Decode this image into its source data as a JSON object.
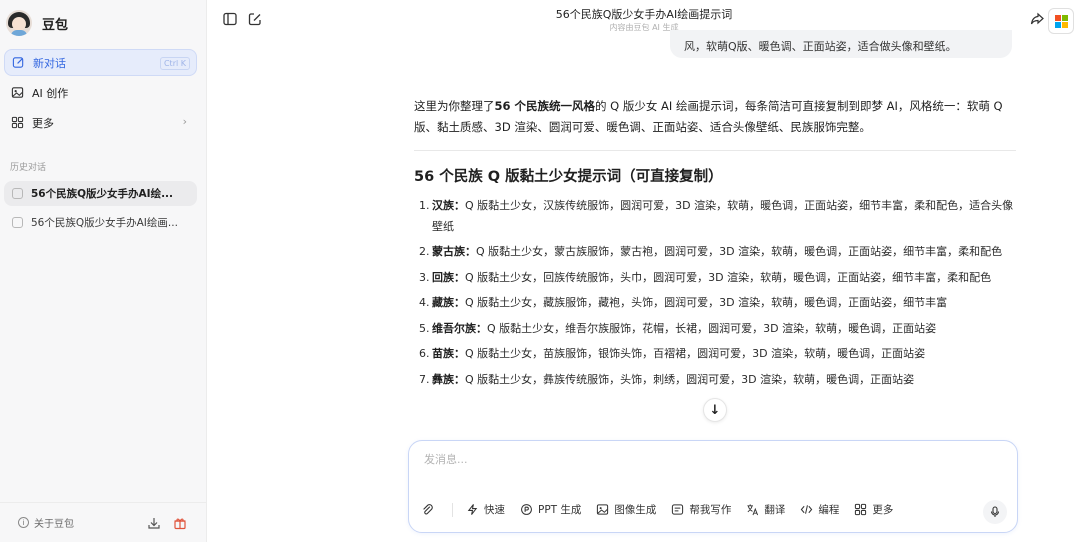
{
  "sidebar": {
    "brand_name": "豆包",
    "nav": [
      {
        "label": "新对话",
        "shortcut": "Ctrl K",
        "icon": "edit-icon",
        "active": true
      },
      {
        "label": "AI 创作",
        "icon": "image-icon"
      },
      {
        "label": "更多",
        "icon": "grid-icon"
      }
    ],
    "history_label": "历史对话",
    "history": [
      {
        "title": "56个民族Q版少女手办AI绘..."
      },
      {
        "title": "56个民族Q版少女手办AI绘画..."
      }
    ],
    "footer_label": "关于豆包"
  },
  "header": {
    "title": "56个民族Q版少女手办AI绘画提示词",
    "subtitle": "内容由豆包 AI 生成"
  },
  "chat": {
    "user_message_tail": "风，软萌Q版、暖色调、正面站姿，适合做头像和壁纸。",
    "intro_prefix": "这里为你整理了",
    "intro_bold": "56 个民族统一风格",
    "intro_mid": "的 Q 版少女 AI 绘画提示词，每条简洁可直接复制到即梦 AI，风格统一：软萌 Q 版、黏土质感、3D 渲染、圆润可爱、暖色调、正面站姿、适合头像壁纸、民族服饰完整。",
    "section_title": "56 个民族 Q 版黏土少女提示词（可直接复制）",
    "prompts": [
      {
        "num": "1.",
        "ethnic": "汉族：",
        "text": "Q 版黏土少女，汉族传统服饰，圆润可爱，3D 渲染，软萌，暖色调，正面站姿，细节丰富，柔和配色，适合头像壁纸"
      },
      {
        "num": "2.",
        "ethnic": "蒙古族：",
        "text": "Q 版黏土少女，蒙古族服饰，蒙古袍，圆润可爱，3D 渲染，软萌，暖色调，正面站姿，细节丰富，柔和配色"
      },
      {
        "num": "3.",
        "ethnic": "回族：",
        "text": "Q 版黏土少女，回族传统服饰，头巾，圆润可爱，3D 渲染，软萌，暖色调，正面站姿，细节丰富，柔和配色"
      },
      {
        "num": "4.",
        "ethnic": "藏族：",
        "text": "Q 版黏土少女，藏族服饰，藏袍，头饰，圆润可爱，3D 渲染，软萌，暖色调，正面站姿，细节丰富"
      },
      {
        "num": "5.",
        "ethnic": "维吾尔族：",
        "text": "Q 版黏土少女，维吾尔族服饰，花帽，长裙，圆润可爱，3D 渲染，软萌，暖色调，正面站姿"
      },
      {
        "num": "6.",
        "ethnic": "苗族：",
        "text": "Q 版黏土少女，苗族服饰，银饰头饰，百褶裙，圆润可爱，3D 渲染，软萌，暖色调，正面站姿"
      },
      {
        "num": "7.",
        "ethnic": "彝族：",
        "text": "Q 版黏土少女，彝族传统服饰，头饰，刺绣，圆润可爱，3D 渲染，软萌，暖色调，正面站姿"
      }
    ]
  },
  "composer": {
    "placeholder": "发消息...",
    "tools": [
      {
        "label": "快速",
        "icon": "lightning-icon"
      },
      {
        "label": "PPT 生成",
        "icon": "ppt-icon"
      },
      {
        "label": "图像生成",
        "icon": "image-icon"
      },
      {
        "label": "帮我写作",
        "icon": "pen-icon"
      },
      {
        "label": "翻译",
        "icon": "translate-icon"
      },
      {
        "label": "编程",
        "icon": "code-icon"
      },
      {
        "label": "更多",
        "icon": "grid-icon"
      }
    ]
  },
  "colors": {
    "accent": "#3467e0",
    "active_bg": "#e6ecfb",
    "sidebar_bg": "#f7f7f8"
  }
}
